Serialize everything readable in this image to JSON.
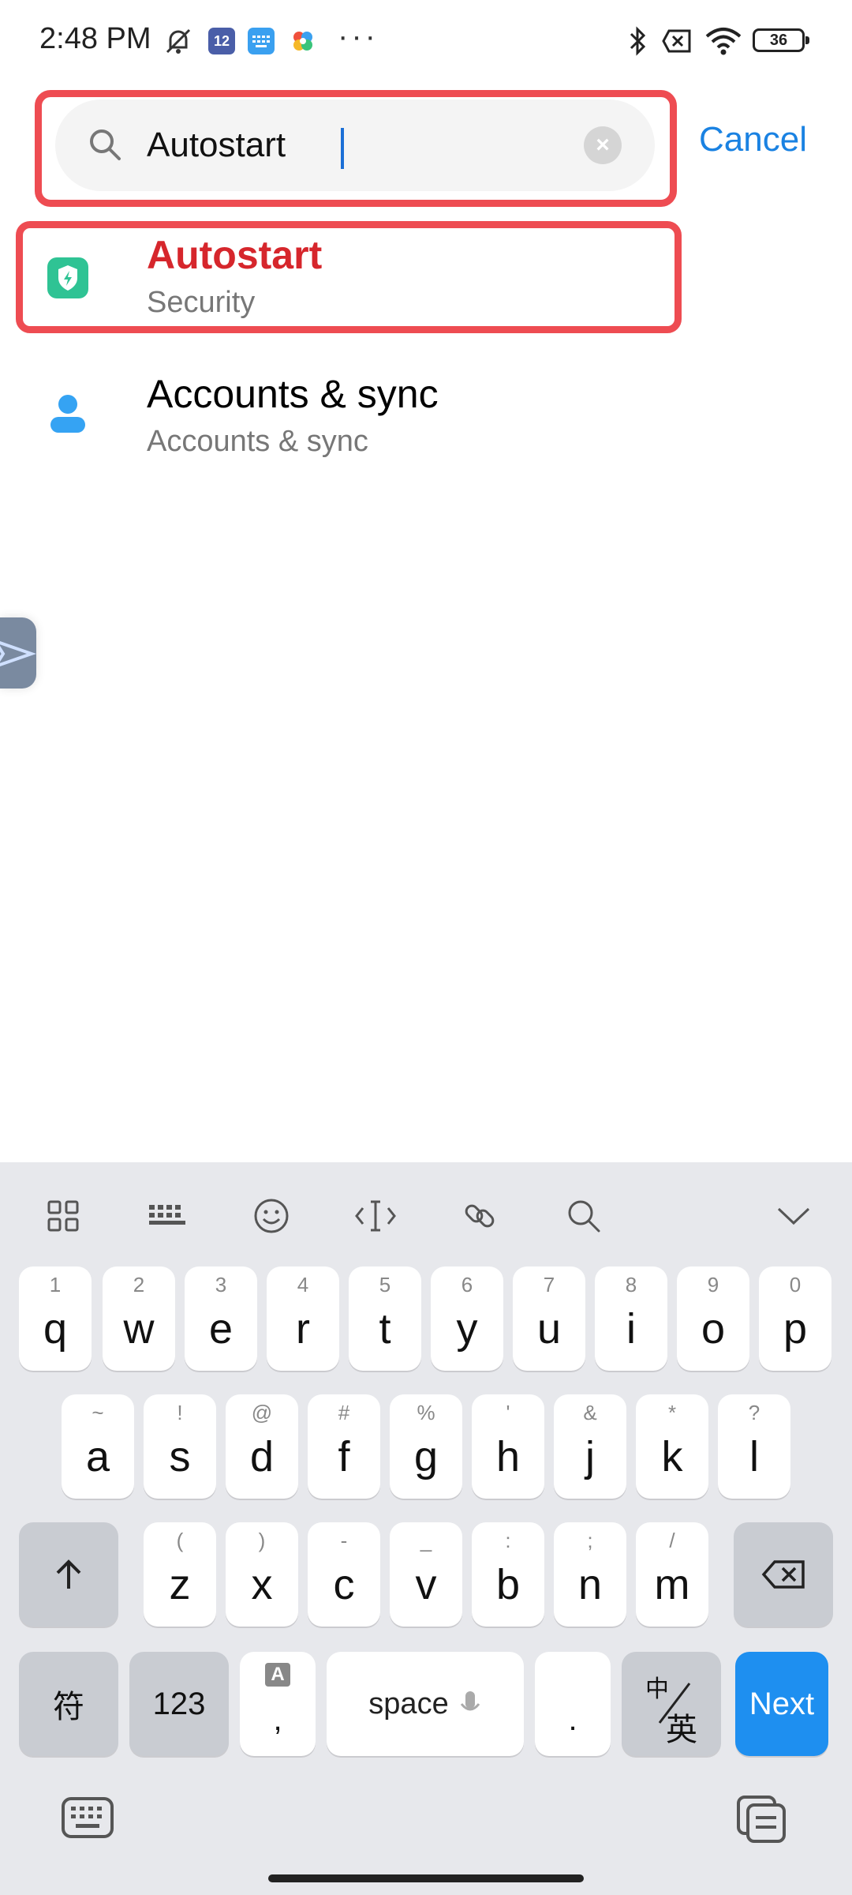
{
  "status_bar": {
    "time": "2:48 PM",
    "battery": "36",
    "app_badge": "12"
  },
  "search": {
    "query": "Autostart",
    "clear_icon": "×",
    "cancel_label": "Cancel"
  },
  "results": [
    {
      "title": "Autostart",
      "subtitle": "Security",
      "icon": "shield-bolt-icon",
      "color": "#2fc394"
    },
    {
      "title": "Accounts & sync",
      "subtitle": "Accounts & sync",
      "icon": "person-icon",
      "color": "#35a3f3"
    }
  ],
  "keyboard": {
    "row1": [
      {
        "hint": "1",
        "key": "q"
      },
      {
        "hint": "2",
        "key": "w"
      },
      {
        "hint": "3",
        "key": "e"
      },
      {
        "hint": "4",
        "key": "r"
      },
      {
        "hint": "5",
        "key": "t"
      },
      {
        "hint": "6",
        "key": "y"
      },
      {
        "hint": "7",
        "key": "u"
      },
      {
        "hint": "8",
        "key": "i"
      },
      {
        "hint": "9",
        "key": "o"
      },
      {
        "hint": "0",
        "key": "p"
      }
    ],
    "row2": [
      {
        "hint": "~",
        "key": "a"
      },
      {
        "hint": "!",
        "key": "s"
      },
      {
        "hint": "@",
        "key": "d"
      },
      {
        "hint": "#",
        "key": "f"
      },
      {
        "hint": "%",
        "key": "g"
      },
      {
        "hint": "'",
        "key": "h"
      },
      {
        "hint": "&",
        "key": "j"
      },
      {
        "hint": "*",
        "key": "k"
      },
      {
        "hint": "?",
        "key": "l"
      }
    ],
    "row3": [
      {
        "hint": "(",
        "key": "z"
      },
      {
        "hint": ")",
        "key": "x"
      },
      {
        "hint": "-",
        "key": "c"
      },
      {
        "hint": "_",
        "key": "v"
      },
      {
        "hint": ":",
        "key": "b"
      },
      {
        "hint": ";",
        "key": "n"
      },
      {
        "hint": "/",
        "key": "m"
      }
    ],
    "symbols_label": "符",
    "numbers_label": "123",
    "comma_hint": "A",
    "comma_key": ",",
    "space_label": "space",
    "period_key": ".",
    "lang_top": "中",
    "lang_bottom": "英",
    "next_label": "Next"
  }
}
